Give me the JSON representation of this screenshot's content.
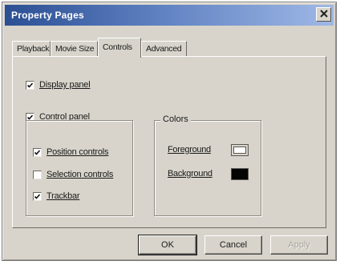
{
  "window": {
    "title": "Property Pages",
    "close_icon": "close-x-icon"
  },
  "tabs": [
    {
      "label": "Playback",
      "active": false
    },
    {
      "label": "Movie Size",
      "active": false
    },
    {
      "label": "Controls",
      "active": true
    },
    {
      "label": "Advanced",
      "active": false
    }
  ],
  "controls": {
    "display_panel": {
      "label": "Display panel",
      "checked": true
    },
    "control_panel": {
      "label": "Control panel",
      "checked": true,
      "options": [
        {
          "label": "Position controls",
          "checked": true
        },
        {
          "label": "Selection controls",
          "checked": false
        },
        {
          "label": "Trackbar",
          "checked": true
        }
      ]
    },
    "colors": {
      "title": "Colors",
      "foreground": {
        "label": "Foreground",
        "color": "#ffffff"
      },
      "background": {
        "label": "Background",
        "color": "#050505"
      }
    }
  },
  "buttons": {
    "ok": "OK",
    "cancel": "Cancel",
    "apply": "Apply"
  }
}
